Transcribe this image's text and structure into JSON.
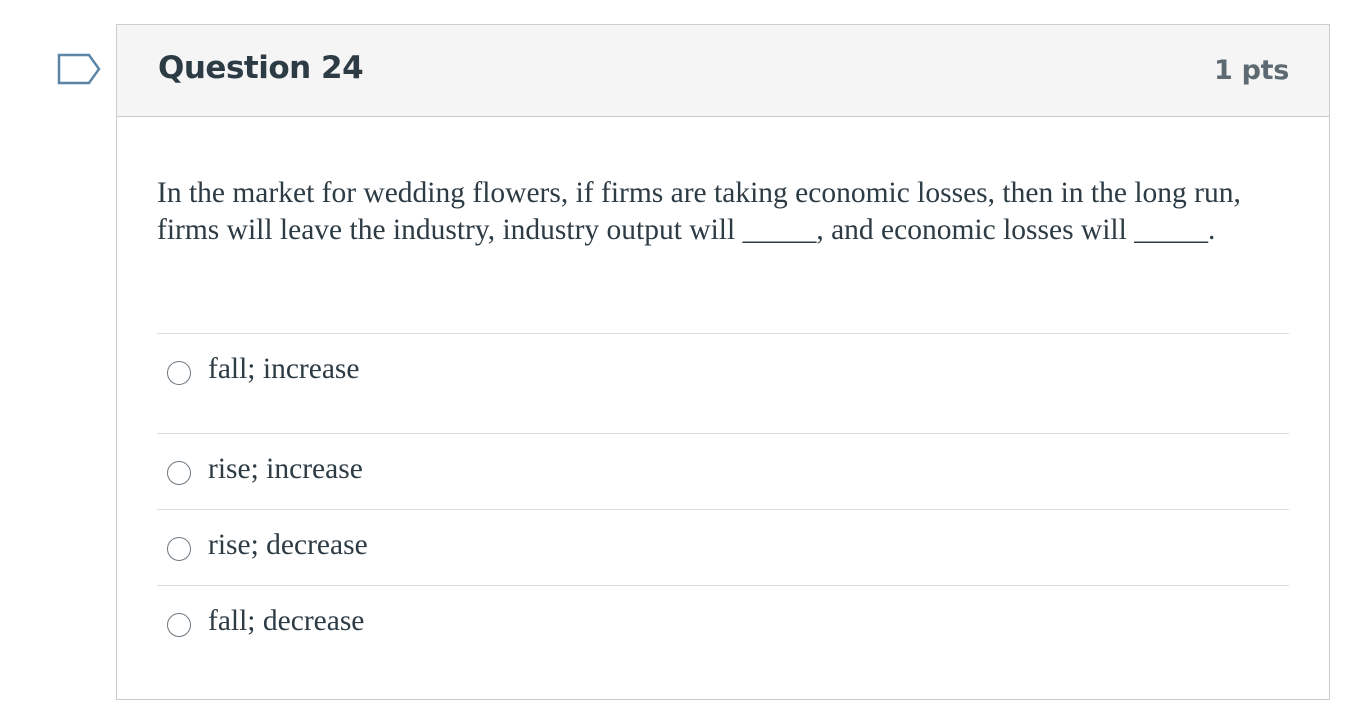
{
  "question": {
    "title": "Question 24",
    "points": "1 pts",
    "text": "In the market for wedding flowers, if firms are taking economic losses, then in the long run, firms will leave the industry, industry output will _____, and economic losses will _____.",
    "flag_icon": "bookmark-flag-icon",
    "answers": [
      {
        "label": "fall; increase",
        "selected": false
      },
      {
        "label": "rise; increase",
        "selected": false
      },
      {
        "label": "rise; decrease",
        "selected": false
      },
      {
        "label": "fall; decrease",
        "selected": false
      }
    ]
  },
  "colors": {
    "header_bg": "#f5f5f5",
    "border": "#c7cdd1",
    "text": "#2d3b45",
    "flag": "#5b86a8"
  }
}
